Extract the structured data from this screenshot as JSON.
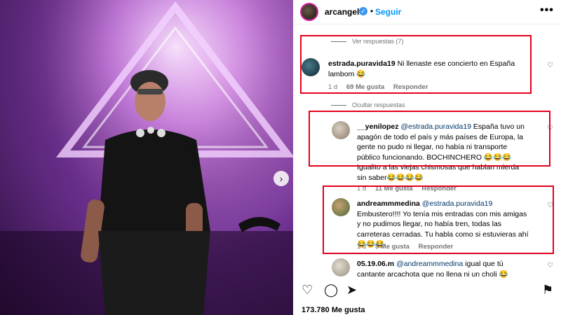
{
  "post": {
    "username": "arcangel",
    "follow_label": "Seguir",
    "more_label": "•••",
    "likes": "173.780 Me gusta"
  },
  "thread": {
    "view_replies_label": "Ver respuestas (7)",
    "hide_replies_label": "Ocultar respuestas"
  },
  "comments": [
    {
      "username": "estrada.puravida19",
      "text": "Ni llenaste ese concierto en España lambom 😂",
      "time": "1 d",
      "likes": "69 Me gusta",
      "reply": "Responder"
    },
    {
      "username": "__yenilopez",
      "mention": "@estrada.puravida19",
      "text": " España tuvo un apagón de todo el país y más países de Europa, la gente no pudo ni llegar, no había ni transporte público funcionando. BOCHINCHERO 😂😂😂 Igualito a las viejas chismosas que hablan mierda sin saber😂😂😂😂",
      "time": "1 d",
      "likes": "11 Me gusta",
      "reply": "Responder"
    },
    {
      "username": "andreammmedina",
      "mention": "@estrada.puravida19",
      "text": " Embustero!!!! Yo tenía mis entradas con mis amigas y no pudimos llegar, no había tren, todas las carreteras cerradas. Tu habla como si estuvieras ahí😂😂😂",
      "time": "1 d",
      "likes": "5 Me gusta",
      "reply": "Responder"
    },
    {
      "username": "05.19.06.m",
      "mention": "@andreammmedina",
      "text": " igual que tú cantante arcachota que no llena ni un choli 😂",
      "time": "",
      "likes": "",
      "reply": ""
    }
  ],
  "icons": [
    "heart-icon",
    "comment-icon",
    "share-icon",
    "bookmark-icon",
    "verified-badge-icon",
    "next-arrow-icon",
    "more-options-icon"
  ],
  "colors": {
    "follow_blue": "#0095f6",
    "highlight_red": "#e3001b",
    "verified_blue": "#3897f0"
  }
}
